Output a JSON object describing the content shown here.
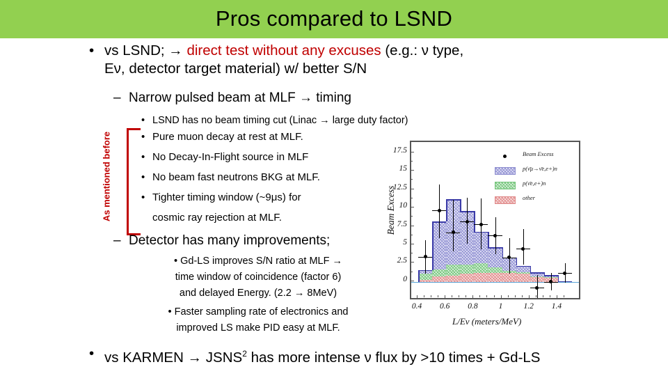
{
  "slide": {
    "title": "Pros compared to LSND",
    "banner_color": "#92D050",
    "accent_red": "#C00000"
  },
  "bullets": {
    "b1": {
      "marker": "•",
      "pre": "vs LSND;  → ",
      "highlight": "direct test without any excuses",
      "post": " (e.g.: ν type,",
      "line2": "Eν, detector target material) w/ better S/N"
    },
    "b2": {
      "marker": "–",
      "text": "Narrow pulsed beam at MLF → timing"
    },
    "sub": [
      {
        "marker": "•",
        "text": "LSND has no beam timing cut (Linac → large duty factor)"
      },
      {
        "marker": "•",
        "text": "Pure muon decay at rest at MLF."
      },
      {
        "marker": "•",
        "text": "No Decay-In-Flight source in MLF"
      },
      {
        "marker": "•",
        "text": "No beam fast neutrons BKG at MLF."
      },
      {
        "marker": "•",
        "text": "Tighter timing window (~9μs) for"
      },
      {
        "marker": "",
        "text": "cosmic ray rejection at MLF."
      }
    ],
    "b3": {
      "marker": "–",
      "text": "Detector has many improvements;"
    },
    "sub2": [
      {
        "marker": "•",
        "text": "Gd-LS improves  S/N ratio at MLF →"
      },
      {
        "marker": "",
        "text": "time window of coincidence (factor 6)"
      },
      {
        "marker": "",
        "text": "and delayed Energy.  (2.2 → 8MeV)"
      },
      {
        "marker": "•",
        "text": "Faster sampling rate of electronics and"
      },
      {
        "marker": "",
        "text": "improved LS make PID easy at MLF."
      }
    ],
    "b4": {
      "marker": "•",
      "pre": "vs KARMEN → JSNS",
      "sup": "2",
      "post": " has more intense ν flux by >10 times + Gd-LS"
    }
  },
  "side_note": {
    "label": "As mentioned before"
  },
  "chart_data": {
    "type": "bar",
    "title": "",
    "xlabel": "L/Eν (meters/MeV)",
    "ylabel": "Beam Excess",
    "xlim": [
      0.35,
      1.55
    ],
    "ylim": [
      -2.2,
      19.0
    ],
    "grid": false,
    "legend_position": "top-right",
    "xticks": [
      "0.4",
      "0.6",
      "0.8",
      "1",
      "1.2",
      "1.4"
    ],
    "xtick_values": [
      0.4,
      0.6,
      0.8,
      1.0,
      1.2,
      1.4
    ],
    "yticks": [
      "0",
      "2.5",
      "5",
      "7.5",
      "10",
      "12.5",
      "15",
      "17.5"
    ],
    "ytick_values": [
      0,
      2.5,
      5,
      7.5,
      10,
      12.5,
      15,
      17.5
    ],
    "bin_edges": [
      0.4,
      0.5,
      0.6,
      0.7,
      0.8,
      0.9,
      1.0,
      1.1,
      1.2,
      1.3,
      1.4,
      1.5
    ],
    "bin_centers": [
      0.45,
      0.55,
      0.65,
      0.75,
      0.85,
      0.95,
      1.05,
      1.15,
      1.25,
      1.35,
      1.45
    ],
    "series": [
      {
        "name": "p(ν̄μ→ν̄e,e+)n",
        "color": "#8f8fd0",
        "values": [
          1.6,
          8.2,
          11.2,
          9.6,
          6.8,
          4.7,
          3.3,
          2.2,
          1.3,
          0.9,
          0.05
        ]
      },
      {
        "name": "p(ν̄e,e+)n",
        "color": "#74c47a",
        "values": [
          1.1,
          1.7,
          2.3,
          2.3,
          2.5,
          2.0,
          1.5,
          1.3,
          0.7,
          0.6,
          0.04
        ]
      },
      {
        "name": "other",
        "color": "#e08a8a",
        "values": [
          0.3,
          0.75,
          0.85,
          1.15,
          1.2,
          1.2,
          1.2,
          1.1,
          0.6,
          0.55,
          0.03
        ]
      }
    ],
    "points": {
      "name": "Beam Excess",
      "x": [
        0.45,
        0.55,
        0.65,
        0.75,
        0.85,
        0.95,
        1.05,
        1.15,
        1.25,
        1.35,
        1.45
      ],
      "y": [
        3.4,
        9.7,
        6.7,
        8.2,
        7.8,
        6.3,
        3.3,
        4.5,
        -0.8,
        0.0,
        1.2
      ],
      "yerr_lo": [
        2.3,
        3.8,
        2.6,
        3.0,
        3.4,
        2.5,
        2.2,
        2.2,
        1.6,
        1.2,
        1.3
      ],
      "yerr_hi": [
        2.3,
        3.5,
        4.4,
        3.2,
        3.5,
        2.5,
        2.6,
        2.7,
        1.7,
        1.2,
        1.3
      ]
    },
    "legend": [
      {
        "label": "Beam Excess",
        "marker": "dot",
        "color": "#000000"
      },
      {
        "label": "p(ν̄μ→ν̄e,e+)n",
        "marker": "swatch",
        "color": "#8f8fd0"
      },
      {
        "label": "p(ν̄e,e+)n",
        "marker": "swatch",
        "color": "#74c47a"
      },
      {
        "label": "other",
        "marker": "swatch",
        "color": "#e08a8a"
      }
    ]
  }
}
